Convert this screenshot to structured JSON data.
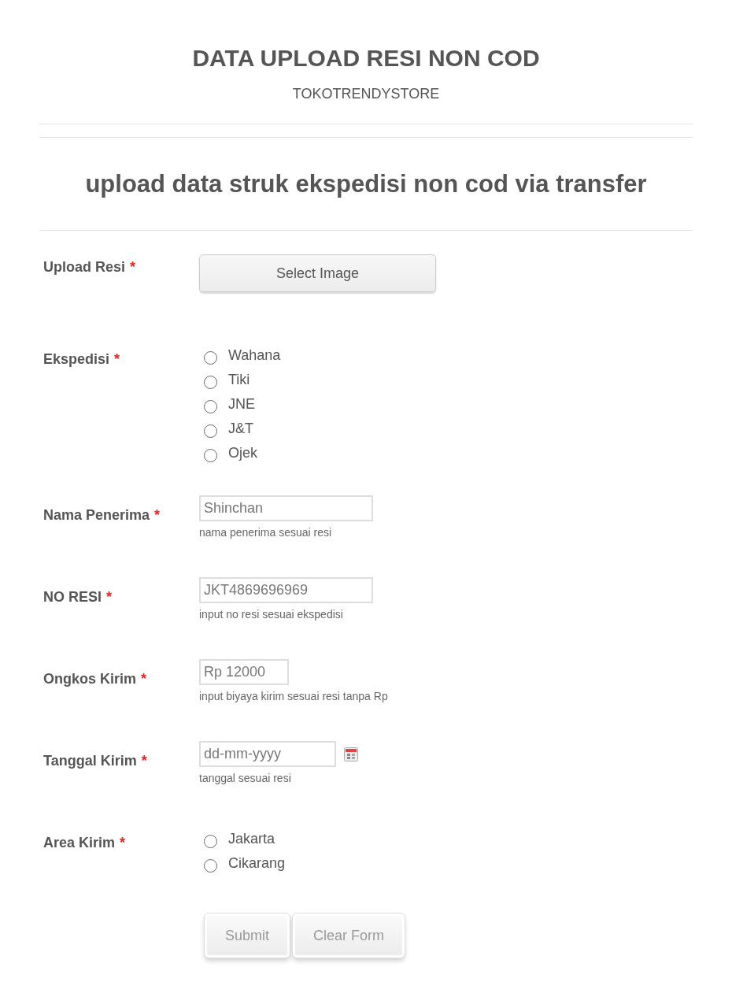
{
  "header": {
    "title": "DATA UPLOAD RESI NON COD",
    "subtitle": "TOKOTRENDYSTORE"
  },
  "section": {
    "heading": "upload data struk ekspedisi non cod via transfer"
  },
  "fields": [
    {
      "kind": "file",
      "label": "Upload Resi",
      "required_mark": "*",
      "button": "Select Image"
    },
    {
      "kind": "radio",
      "label": "Ekspedisi",
      "required_mark": "*",
      "options": [
        {
          "label": "Wahana",
          "selected": false
        },
        {
          "label": "Tiki",
          "selected": false
        },
        {
          "label": "JNE",
          "selected": false
        },
        {
          "label": "J&T",
          "selected": false
        },
        {
          "label": "Ojek",
          "selected": false
        }
      ]
    },
    {
      "kind": "text",
      "label": "Nama Penerima",
      "required_mark": "*",
      "placeholder": "Shinchan",
      "hint": "nama penerima sesuai resi"
    },
    {
      "kind": "text",
      "label": "NO RESI",
      "required_mark": "*",
      "placeholder": "JKT4869696969",
      "hint": "input no resi sesuai ekspedisi"
    },
    {
      "kind": "text",
      "label": "Ongkos Kirim",
      "required_mark": "*",
      "placeholder": "Rp 12000",
      "hint": "input biyaya kirim sesuai resi tanpa Rp"
    },
    {
      "kind": "date",
      "label": "Tanggal Kirim",
      "required_mark": "*",
      "placeholder": "dd-mm-yyyy",
      "hint": "tanggal sesuai resi"
    },
    {
      "kind": "radio",
      "label": "Area Kirim",
      "required_mark": "*",
      "options": [
        {
          "label": "Jakarta",
          "selected": false
        },
        {
          "label": "Cikarang",
          "selected": false
        }
      ]
    }
  ],
  "buttons": [
    "Submit",
    "Clear Form"
  ]
}
